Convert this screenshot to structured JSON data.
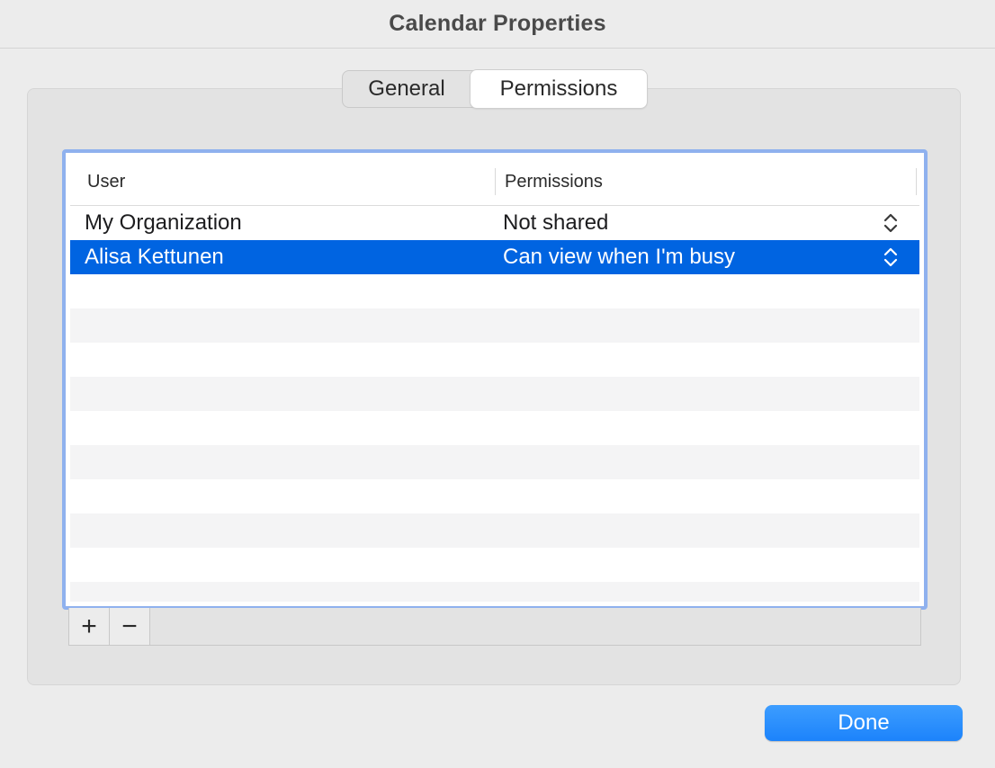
{
  "window": {
    "title": "Calendar Properties"
  },
  "tabs": [
    {
      "label": "General",
      "selected": false
    },
    {
      "label": "Permissions",
      "selected": true
    }
  ],
  "table": {
    "columns": {
      "user": "User",
      "permissions": "Permissions"
    },
    "rows": [
      {
        "user": "My Organization",
        "permission": "Not shared",
        "selected": false
      },
      {
        "user": "Alisa Kettunen",
        "permission": "Can view when I'm busy",
        "selected": true
      }
    ],
    "stepper_icon": "updown-chevron-icon"
  },
  "bottom_bar": {
    "add_label": "+",
    "remove_label": "−"
  },
  "footer": {
    "done_label": "Done"
  },
  "colors": {
    "selection": "#0064e1",
    "focus_ring": "#8fb1ee",
    "done_button": "#1c83fb"
  }
}
